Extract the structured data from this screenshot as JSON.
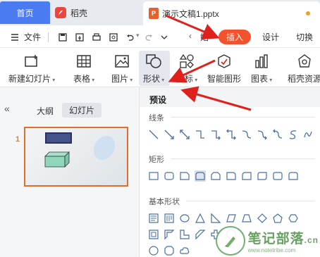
{
  "tabs": {
    "home": "首页",
    "wk": "稻壳",
    "doc": "演示文稿1.pptx"
  },
  "menu": {
    "file": "文件",
    "partial_item": "始",
    "insert": "插入",
    "design": "设计",
    "switch": "切换"
  },
  "ribbon": {
    "new_slide": "新建幻灯片",
    "table": "表格",
    "picture": "图片",
    "shape": "形状",
    "icon": "图标",
    "smartart": "智能图形",
    "chart": "图表",
    "wk_resource": "稻壳资源"
  },
  "left_panel": {
    "collapse": "«",
    "outline_tab": "大纲",
    "slides_tab": "幻灯片",
    "slide_number": "1"
  },
  "shape_dropdown": {
    "title": "预设",
    "sections": [
      "线条",
      "矩形",
      "基本形状"
    ]
  },
  "watermark": {
    "main": "笔记部落",
    "suffix": ".cn",
    "url": "www.notetribe.com"
  },
  "colors": {
    "accent_blue": "#4a7bf0",
    "insert_red": "#f4522d",
    "arrow_red": "#e0201c",
    "slide_border": "#e06c2d"
  }
}
